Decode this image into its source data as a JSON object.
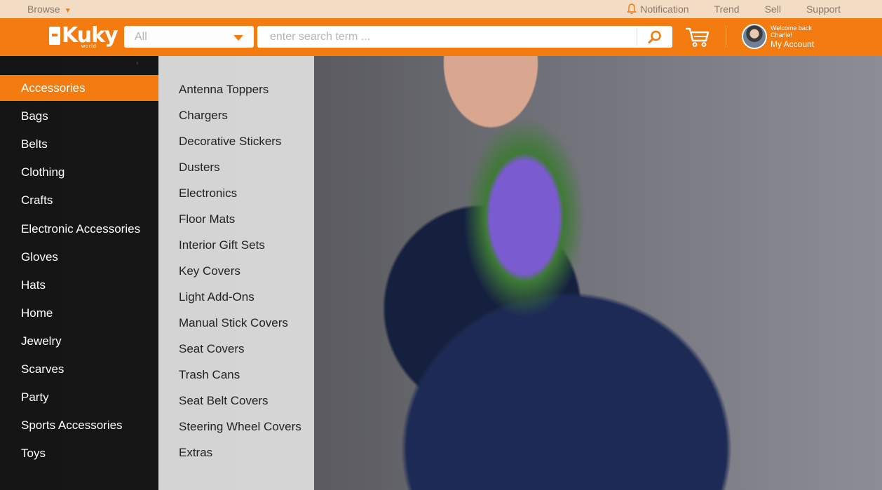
{
  "topbar": {
    "browse_label": "Browse",
    "links": [
      "Notification",
      "Trend",
      "Sell",
      "Support"
    ]
  },
  "header": {
    "logo_text": "Kuky",
    "logo_sub": "world",
    "category_select_value": "All",
    "search_placeholder": "enter search term ...",
    "account": {
      "welcome": "Welcome back",
      "name": "Charlie!",
      "link": "My Account"
    }
  },
  "categories": {
    "active_index": 0,
    "items": [
      "Accessories",
      "Bags",
      "Belts",
      "Clothing",
      "Crafts",
      "Electronic Accessories",
      "Gloves",
      "Hats",
      "Home",
      "Jewelry",
      "Scarves",
      "Party",
      "Sports Accessories",
      "Toys"
    ]
  },
  "subcategories": {
    "items": [
      "Antenna Toppers",
      "Chargers",
      "Decorative Stickers",
      "Dusters",
      "Electronics",
      "Floor Mats",
      "Interior Gift Sets",
      "Key Covers",
      "Light Add-Ons",
      "Manual Stick Covers",
      "Seat Covers",
      "Trash Cans",
      "Seat Belt Covers",
      "Steering Wheel Covers",
      "Extras"
    ]
  },
  "colors": {
    "accent": "#f47b0f",
    "topbar_bg": "#f3dcc4"
  }
}
